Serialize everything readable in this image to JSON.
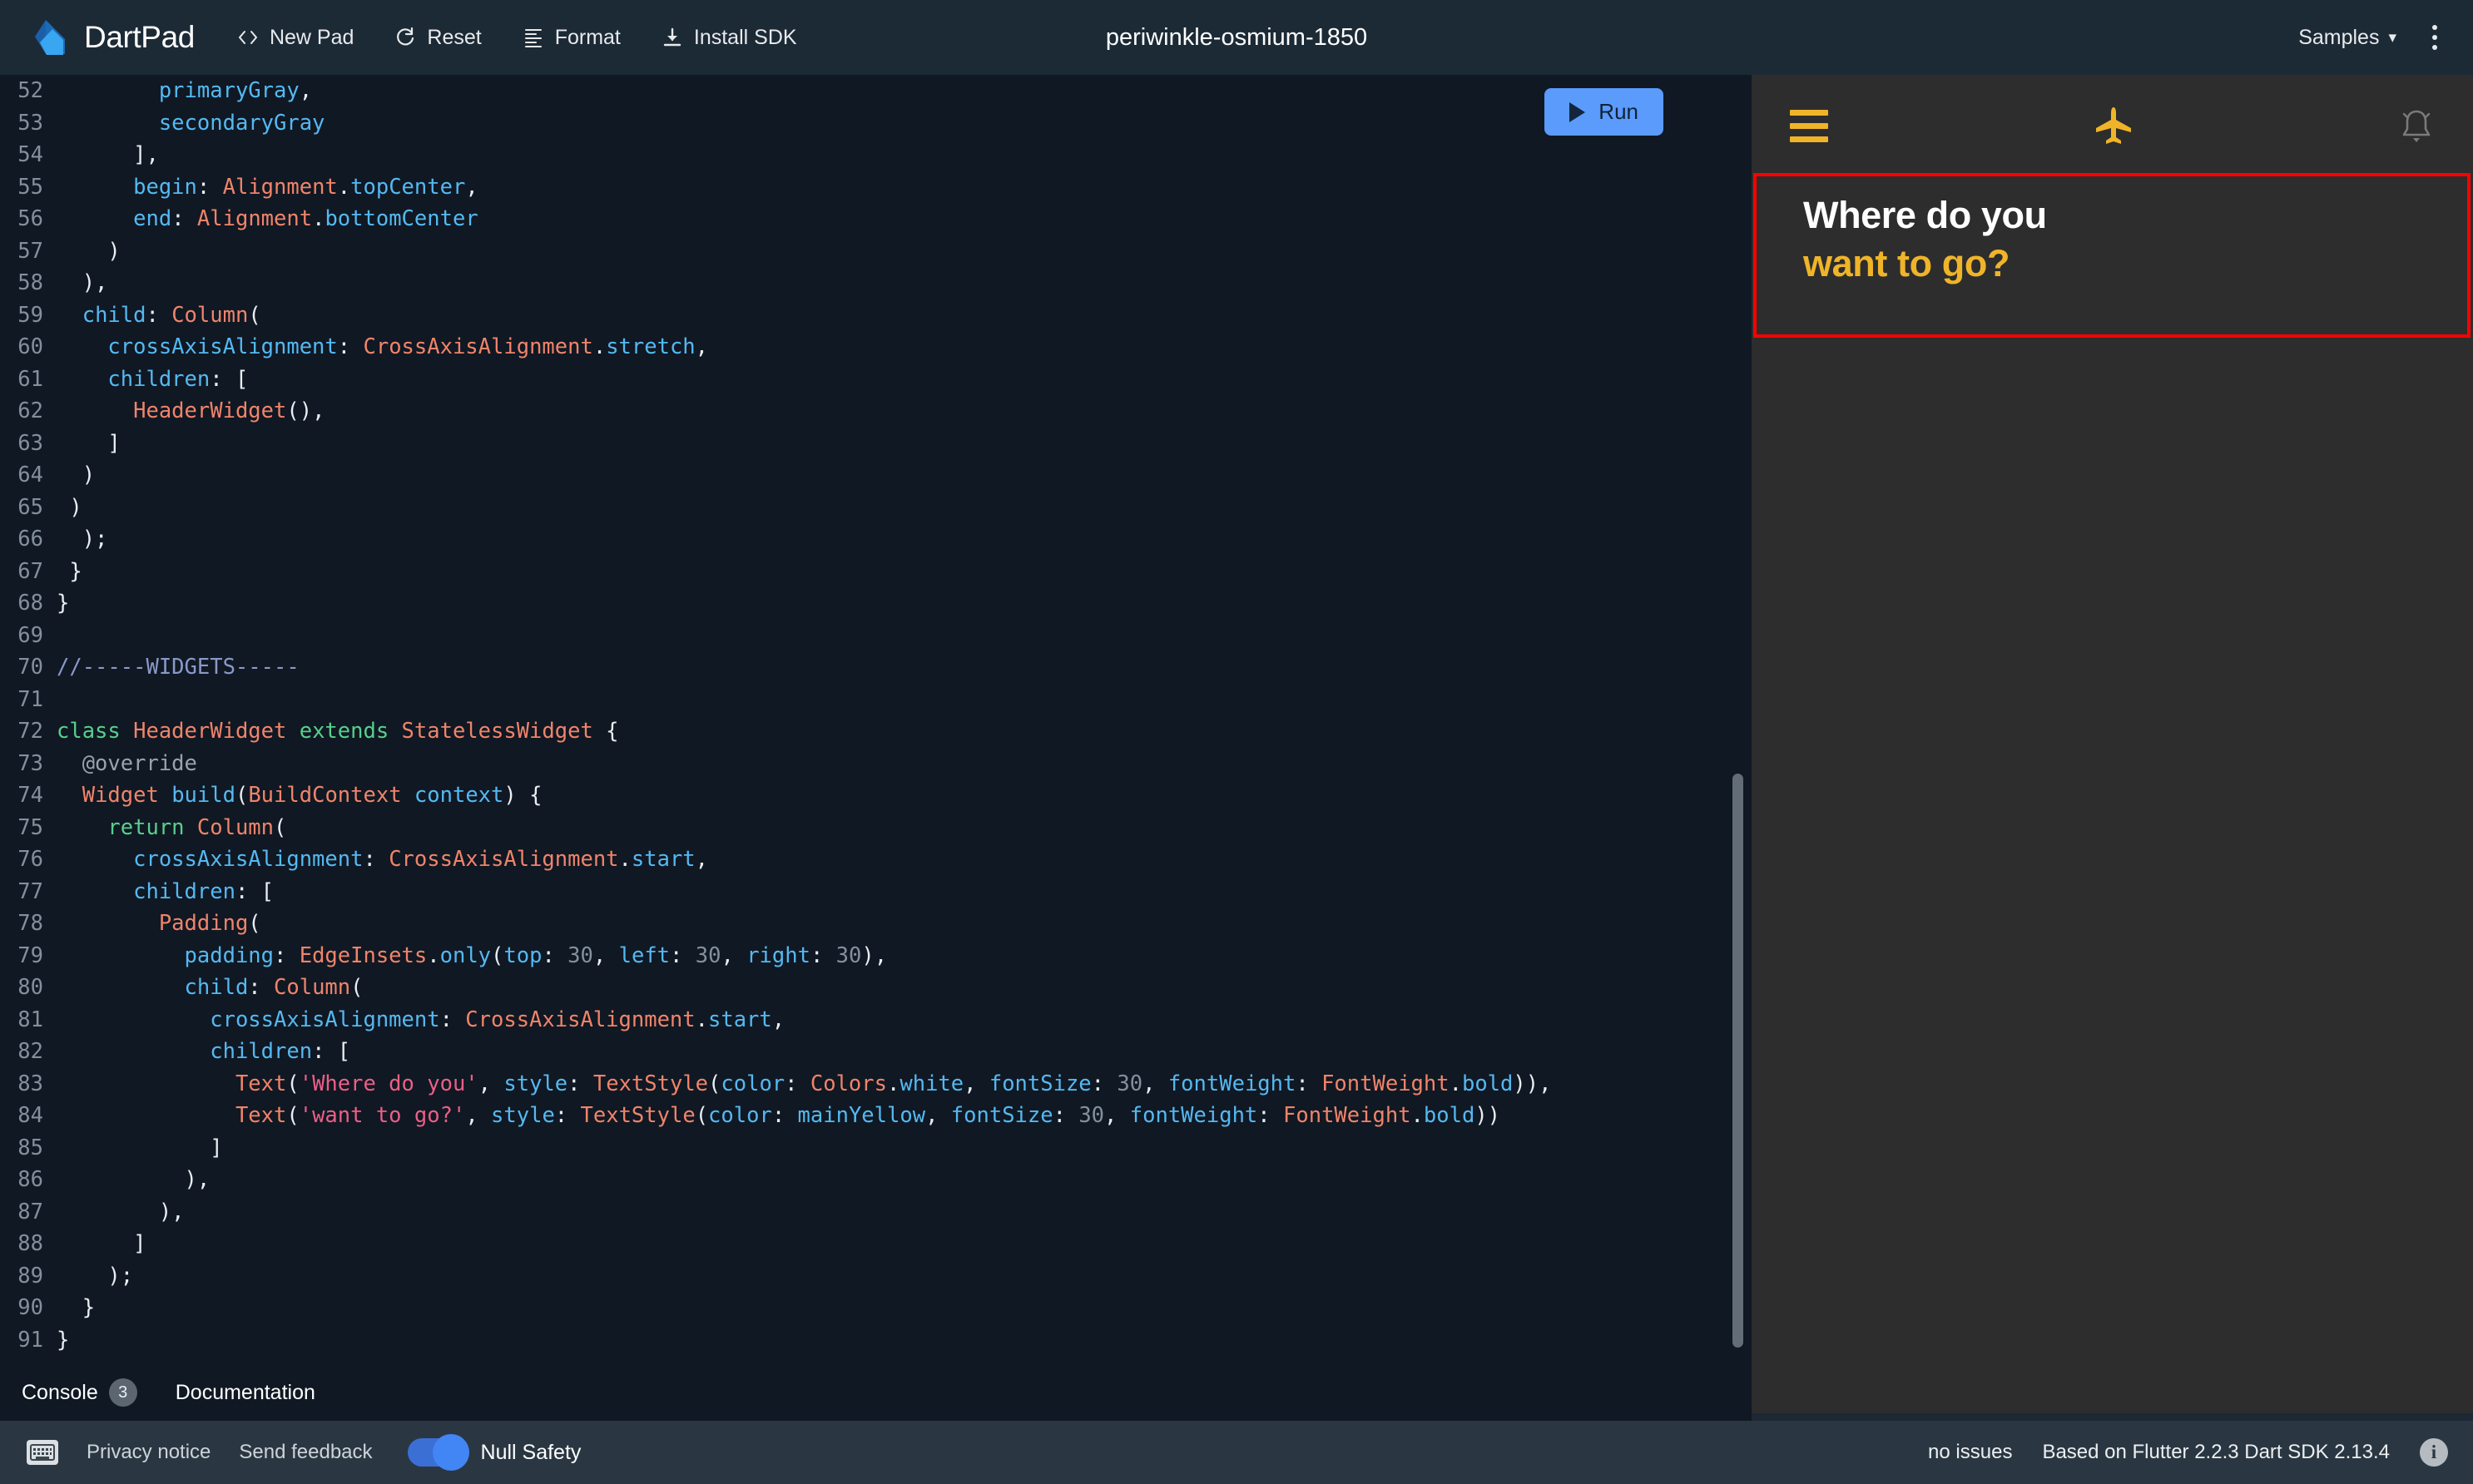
{
  "header": {
    "brand": "DartPad",
    "logo_icon": "dart-logo-icon",
    "actions": [
      {
        "label": "New Pad",
        "icon": "code-brackets-icon"
      },
      {
        "label": "Reset",
        "icon": "refresh-icon"
      },
      {
        "label": "Format",
        "icon": "format-lines-icon"
      },
      {
        "label": "Install SDK",
        "icon": "download-icon"
      }
    ],
    "doc_title": "periwinkle-osmium-1850",
    "samples_label": "Samples",
    "samples_chevron": "chevron-down-icon",
    "more_menu_icon": "kebab-menu-icon"
  },
  "editor": {
    "run_label": "Run",
    "run_icon": "play-triangle-icon",
    "first_line": 52,
    "lines": [
      {
        "n": 52,
        "tokens": [
          {
            "t": "        ",
            "c": "pun"
          },
          {
            "t": "primaryGray",
            "c": "idn"
          },
          {
            "t": ",",
            "c": "pun"
          }
        ]
      },
      {
        "n": 53,
        "tokens": [
          {
            "t": "        ",
            "c": "pun"
          },
          {
            "t": "secondaryGray",
            "c": "idn"
          }
        ]
      },
      {
        "n": 54,
        "tokens": [
          {
            "t": "      ],",
            "c": "pun"
          }
        ]
      },
      {
        "n": 55,
        "tokens": [
          {
            "t": "      ",
            "c": "pun"
          },
          {
            "t": "begin",
            "c": "idn"
          },
          {
            "t": ": ",
            "c": "pun"
          },
          {
            "t": "Alignment",
            "c": "typ"
          },
          {
            "t": ".",
            "c": "pun"
          },
          {
            "t": "topCenter",
            "c": "idn"
          },
          {
            "t": ",",
            "c": "pun"
          }
        ]
      },
      {
        "n": 56,
        "tokens": [
          {
            "t": "      ",
            "c": "pun"
          },
          {
            "t": "end",
            "c": "idn"
          },
          {
            "t": ": ",
            "c": "pun"
          },
          {
            "t": "Alignment",
            "c": "typ"
          },
          {
            "t": ".",
            "c": "pun"
          },
          {
            "t": "bottomCenter",
            "c": "idn"
          }
        ]
      },
      {
        "n": 57,
        "tokens": [
          {
            "t": "    )",
            "c": "pun"
          }
        ]
      },
      {
        "n": 58,
        "tokens": [
          {
            "t": "  ),",
            "c": "pun"
          }
        ]
      },
      {
        "n": 59,
        "tokens": [
          {
            "t": "  ",
            "c": "pun"
          },
          {
            "t": "child",
            "c": "idn"
          },
          {
            "t": ": ",
            "c": "pun"
          },
          {
            "t": "Column",
            "c": "typ"
          },
          {
            "t": "(",
            "c": "pun"
          }
        ]
      },
      {
        "n": 60,
        "tokens": [
          {
            "t": "    ",
            "c": "pun"
          },
          {
            "t": "crossAxisAlignment",
            "c": "idn"
          },
          {
            "t": ": ",
            "c": "pun"
          },
          {
            "t": "CrossAxisAlignment",
            "c": "typ"
          },
          {
            "t": ".",
            "c": "pun"
          },
          {
            "t": "stretch",
            "c": "idn"
          },
          {
            "t": ",",
            "c": "pun"
          }
        ]
      },
      {
        "n": 61,
        "tokens": [
          {
            "t": "    ",
            "c": "pun"
          },
          {
            "t": "children",
            "c": "idn"
          },
          {
            "t": ": [",
            "c": "pun"
          }
        ]
      },
      {
        "n": 62,
        "tokens": [
          {
            "t": "      ",
            "c": "pun"
          },
          {
            "t": "HeaderWidget",
            "c": "typ"
          },
          {
            "t": "(),",
            "c": "pun"
          }
        ]
      },
      {
        "n": 63,
        "tokens": [
          {
            "t": "    ]",
            "c": "pun"
          }
        ]
      },
      {
        "n": 64,
        "tokens": [
          {
            "t": "  )",
            "c": "pun"
          }
        ]
      },
      {
        "n": 65,
        "tokens": [
          {
            "t": " )",
            "c": "pun"
          }
        ]
      },
      {
        "n": 66,
        "tokens": [
          {
            "t": "  );",
            "c": "pun"
          }
        ]
      },
      {
        "n": 67,
        "tokens": [
          {
            "t": " }",
            "c": "pun"
          }
        ]
      },
      {
        "n": 68,
        "tokens": [
          {
            "t": "}",
            "c": "pun"
          }
        ]
      },
      {
        "n": 69,
        "tokens": []
      },
      {
        "n": 70,
        "tokens": [
          {
            "t": "//-----WIDGETS-----",
            "c": "cmt"
          }
        ]
      },
      {
        "n": 71,
        "tokens": []
      },
      {
        "n": 72,
        "tokens": [
          {
            "t": "class ",
            "c": "kw"
          },
          {
            "t": "HeaderWidget",
            "c": "typ"
          },
          {
            "t": " extends ",
            "c": "kw"
          },
          {
            "t": "StatelessWidget",
            "c": "typ"
          },
          {
            "t": " {",
            "c": "pun"
          }
        ]
      },
      {
        "n": 73,
        "tokens": [
          {
            "t": "  @override",
            "c": "ann"
          }
        ]
      },
      {
        "n": 74,
        "tokens": [
          {
            "t": "  ",
            "c": "pun"
          },
          {
            "t": "Widget",
            "c": "typ"
          },
          {
            "t": " ",
            "c": "pun"
          },
          {
            "t": "build",
            "c": "fn"
          },
          {
            "t": "(",
            "c": "pun"
          },
          {
            "t": "BuildContext",
            "c": "typ"
          },
          {
            "t": " ",
            "c": "pun"
          },
          {
            "t": "context",
            "c": "idn"
          },
          {
            "t": ") {",
            "c": "pun"
          }
        ]
      },
      {
        "n": 75,
        "tokens": [
          {
            "t": "    ",
            "c": "pun"
          },
          {
            "t": "return ",
            "c": "kw"
          },
          {
            "t": "Column",
            "c": "typ"
          },
          {
            "t": "(",
            "c": "pun"
          }
        ]
      },
      {
        "n": 76,
        "tokens": [
          {
            "t": "      ",
            "c": "pun"
          },
          {
            "t": "crossAxisAlignment",
            "c": "idn"
          },
          {
            "t": ": ",
            "c": "pun"
          },
          {
            "t": "CrossAxisAlignment",
            "c": "typ"
          },
          {
            "t": ".",
            "c": "pun"
          },
          {
            "t": "start",
            "c": "idn"
          },
          {
            "t": ",",
            "c": "pun"
          }
        ]
      },
      {
        "n": 77,
        "tokens": [
          {
            "t": "      ",
            "c": "pun"
          },
          {
            "t": "children",
            "c": "idn"
          },
          {
            "t": ": [",
            "c": "pun"
          }
        ]
      },
      {
        "n": 78,
        "tokens": [
          {
            "t": "        ",
            "c": "pun"
          },
          {
            "t": "Padding",
            "c": "typ"
          },
          {
            "t": "(",
            "c": "pun"
          }
        ]
      },
      {
        "n": 79,
        "tokens": [
          {
            "t": "          ",
            "c": "pun"
          },
          {
            "t": "padding",
            "c": "idn"
          },
          {
            "t": ": ",
            "c": "pun"
          },
          {
            "t": "EdgeInsets",
            "c": "typ"
          },
          {
            "t": ".",
            "c": "pun"
          },
          {
            "t": "only",
            "c": "idn"
          },
          {
            "t": "(",
            "c": "pun"
          },
          {
            "t": "top",
            "c": "idn"
          },
          {
            "t": ": ",
            "c": "pun"
          },
          {
            "t": "30",
            "c": "num"
          },
          {
            "t": ", ",
            "c": "pun"
          },
          {
            "t": "left",
            "c": "idn"
          },
          {
            "t": ": ",
            "c": "pun"
          },
          {
            "t": "30",
            "c": "num"
          },
          {
            "t": ", ",
            "c": "pun"
          },
          {
            "t": "right",
            "c": "idn"
          },
          {
            "t": ": ",
            "c": "pun"
          },
          {
            "t": "30",
            "c": "num"
          },
          {
            "t": "),",
            "c": "pun"
          }
        ]
      },
      {
        "n": 80,
        "tokens": [
          {
            "t": "          ",
            "c": "pun"
          },
          {
            "t": "child",
            "c": "idn"
          },
          {
            "t": ": ",
            "c": "pun"
          },
          {
            "t": "Column",
            "c": "typ"
          },
          {
            "t": "(",
            "c": "pun"
          }
        ]
      },
      {
        "n": 81,
        "tokens": [
          {
            "t": "            ",
            "c": "pun"
          },
          {
            "t": "crossAxisAlignment",
            "c": "idn"
          },
          {
            "t": ": ",
            "c": "pun"
          },
          {
            "t": "CrossAxisAlignment",
            "c": "typ"
          },
          {
            "t": ".",
            "c": "pun"
          },
          {
            "t": "start",
            "c": "idn"
          },
          {
            "t": ",",
            "c": "pun"
          }
        ]
      },
      {
        "n": 82,
        "tokens": [
          {
            "t": "            ",
            "c": "pun"
          },
          {
            "t": "children",
            "c": "idn"
          },
          {
            "t": ": [",
            "c": "pun"
          }
        ]
      },
      {
        "n": 83,
        "tokens": [
          {
            "t": "              ",
            "c": "pun"
          },
          {
            "t": "Text",
            "c": "typ"
          },
          {
            "t": "(",
            "c": "pun"
          },
          {
            "t": "'Where do you'",
            "c": "str"
          },
          {
            "t": ", ",
            "c": "pun"
          },
          {
            "t": "style",
            "c": "idn"
          },
          {
            "t": ": ",
            "c": "pun"
          },
          {
            "t": "TextStyle",
            "c": "typ"
          },
          {
            "t": "(",
            "c": "pun"
          },
          {
            "t": "color",
            "c": "idn"
          },
          {
            "t": ": ",
            "c": "pun"
          },
          {
            "t": "Colors",
            "c": "typ"
          },
          {
            "t": ".",
            "c": "pun"
          },
          {
            "t": "white",
            "c": "idn"
          },
          {
            "t": ", ",
            "c": "pun"
          },
          {
            "t": "fontSize",
            "c": "idn"
          },
          {
            "t": ": ",
            "c": "pun"
          },
          {
            "t": "30",
            "c": "num"
          },
          {
            "t": ", ",
            "c": "pun"
          },
          {
            "t": "fontWeight",
            "c": "idn"
          },
          {
            "t": ": ",
            "c": "pun"
          },
          {
            "t": "FontWeight",
            "c": "typ"
          },
          {
            "t": ".",
            "c": "pun"
          },
          {
            "t": "bold",
            "c": "idn"
          },
          {
            "t": ")),",
            "c": "pun"
          }
        ]
      },
      {
        "n": 84,
        "tokens": [
          {
            "t": "              ",
            "c": "pun"
          },
          {
            "t": "Text",
            "c": "typ"
          },
          {
            "t": "(",
            "c": "pun"
          },
          {
            "t": "'want to go?'",
            "c": "str"
          },
          {
            "t": ", ",
            "c": "pun"
          },
          {
            "t": "style",
            "c": "idn"
          },
          {
            "t": ": ",
            "c": "pun"
          },
          {
            "t": "TextStyle",
            "c": "typ"
          },
          {
            "t": "(",
            "c": "pun"
          },
          {
            "t": "color",
            "c": "idn"
          },
          {
            "t": ": ",
            "c": "pun"
          },
          {
            "t": "mainYellow",
            "c": "idn"
          },
          {
            "t": ", ",
            "c": "pun"
          },
          {
            "t": "fontSize",
            "c": "idn"
          },
          {
            "t": ": ",
            "c": "pun"
          },
          {
            "t": "30",
            "c": "num"
          },
          {
            "t": ", ",
            "c": "pun"
          },
          {
            "t": "fontWeight",
            "c": "idn"
          },
          {
            "t": ": ",
            "c": "pun"
          },
          {
            "t": "FontWeight",
            "c": "typ"
          },
          {
            "t": ".",
            "c": "pun"
          },
          {
            "t": "bold",
            "c": "idn"
          },
          {
            "t": "))",
            "c": "pun"
          }
        ]
      },
      {
        "n": 85,
        "tokens": [
          {
            "t": "            ]",
            "c": "pun"
          }
        ]
      },
      {
        "n": 86,
        "tokens": [
          {
            "t": "          ),",
            "c": "pun"
          }
        ]
      },
      {
        "n": 87,
        "tokens": [
          {
            "t": "        ),",
            "c": "pun"
          }
        ]
      },
      {
        "n": 88,
        "tokens": [
          {
            "t": "      ]",
            "c": "pun"
          }
        ]
      },
      {
        "n": 89,
        "tokens": [
          {
            "t": "    );",
            "c": "pun"
          }
        ]
      },
      {
        "n": 90,
        "tokens": [
          {
            "t": "  }",
            "c": "pun"
          }
        ]
      },
      {
        "n": 91,
        "tokens": [
          {
            "t": "}",
            "c": "pun"
          }
        ]
      }
    ]
  },
  "console": {
    "tabs": [
      {
        "label": "Console",
        "badge": "3"
      },
      {
        "label": "Documentation",
        "badge": ""
      }
    ]
  },
  "preview": {
    "menu_icon": "hamburger-menu-icon",
    "app_icon": "airplane-icon",
    "notification_icon": "bell-icon",
    "headline_line1": "Where do you",
    "headline_line2": "want to go?",
    "highlight_border_color": "#ff0000",
    "accent_color": "#f0b429",
    "background_color": "#2d2d2d"
  },
  "status": {
    "keyboard_icon": "keyboard-icon",
    "privacy_label": "Privacy notice",
    "feedback_label": "Send feedback",
    "null_safety_label": "Null Safety",
    "issues_label": "no issues",
    "version_label": "Based on Flutter 2.2.3 Dart SDK 2.13.4",
    "info_icon": "info-icon",
    "info_glyph": "i"
  }
}
